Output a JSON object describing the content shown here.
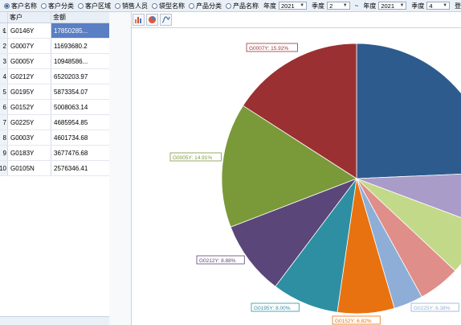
{
  "toolbar": {
    "radios": [
      {
        "label": "客户名称",
        "checked": true
      },
      {
        "label": "客户分类",
        "checked": false
      },
      {
        "label": "客户区域",
        "checked": false
      },
      {
        "label": "销售人员",
        "checked": false
      },
      {
        "label": "袋型名称",
        "checked": false
      },
      {
        "label": "产品分类",
        "checked": false
      },
      {
        "label": "产品名称",
        "checked": false
      }
    ],
    "year_label": "年度",
    "year_from": "2021",
    "quarter_label": "季度",
    "quarter_from": "2",
    "tilde": "~",
    "year_label2": "年度",
    "year_to": "2021",
    "quarter_label2": "季度",
    "quarter_to": "4",
    "login_label": "登"
  },
  "grid": {
    "headers": [
      "客户",
      "金额"
    ],
    "rows": [
      {
        "num": "1",
        "code": "G0146Y",
        "amount": "17850285...",
        "selected": true
      },
      {
        "num": "2",
        "code": "G0007Y",
        "amount": "11693680.2"
      },
      {
        "num": "3",
        "code": "G0005Y",
        "amount": "10948586..."
      },
      {
        "num": "4",
        "code": "G0212Y",
        "amount": "6520203.97"
      },
      {
        "num": "5",
        "code": "G0195Y",
        "amount": "5873354.07"
      },
      {
        "num": "6",
        "code": "G0152Y",
        "amount": "5008063.14"
      },
      {
        "num": "7",
        "code": "G0225Y",
        "amount": "4685954.85"
      },
      {
        "num": "8",
        "code": "G0003Y",
        "amount": "4601734.68"
      },
      {
        "num": "9",
        "code": "G0183Y",
        "amount": "3677476.68"
      },
      {
        "num": "10",
        "code": "G0105N",
        "amount": "2576346.41"
      }
    ],
    "row_indicator": "›"
  },
  "chart_tools": [
    "bar-chart-icon",
    "pie-chart-icon",
    "line-chart-icon"
  ],
  "chart_data": {
    "type": "pie",
    "slices": [
      {
        "name": "G0146Y",
        "value": 17850285,
        "color": "#2e5b8e",
        "label": "",
        "start": 0.0
      },
      {
        "name": "G0225Y",
        "value": 4685954.85,
        "color": "#a99cc8",
        "label": ""
      },
      {
        "name": "G0003Y",
        "value": 4601734.68,
        "color": "#c3d98a",
        "label": ""
      },
      {
        "name": "G0183Y",
        "value": 3677476.68,
        "color": "#df8e8a",
        "label": ""
      },
      {
        "name": "G0105N",
        "value": 2576346.41,
        "color": "#8eaed8",
        "label": "G0225Y: 6.38%"
      },
      {
        "name": "G0152Y",
        "value": 5008063.14,
        "color": "#e8720f",
        "label": "G0152Y: 6.82%"
      },
      {
        "name": "G0195Y",
        "value": 5873354.07,
        "color": "#2e8fa3",
        "label": "G0195Y: 8.00%"
      },
      {
        "name": "G0212Y",
        "value": 6520203.97,
        "color": "#5a4678",
        "label": "G0212Y: 8.88%"
      },
      {
        "name": "G0005Y",
        "value": 10948586,
        "color": "#7a9a3a",
        "label": "G0005Y: 14.91%"
      },
      {
        "name": "G0007Y",
        "value": 11693680.2,
        "color": "#9b3032",
        "label": "G0007Y: 15.92%"
      }
    ]
  }
}
